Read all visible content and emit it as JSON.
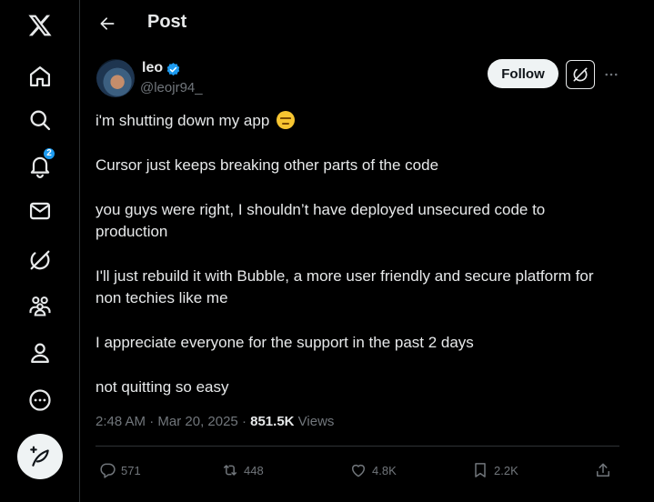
{
  "header": {
    "title": "Post"
  },
  "nav": {
    "notifications_badge": "2"
  },
  "author": {
    "display_name": "leo",
    "handle": "@leojr94_"
  },
  "buttons": {
    "follow_label": "Follow"
  },
  "post": {
    "line1": "i'm shutting down my app",
    "line2": "Cursor just keeps breaking other parts of the code",
    "line3": "you guys were right, I shouldn’t have deployed unsecured code to production",
    "line4": "I'll just rebuild it with Bubble, a more user friendly and secure platform for non techies like me",
    "line5": "I appreciate everyone for the support in the past 2 days",
    "line6": "not quitting so easy",
    "emoji": "expressionless-face"
  },
  "meta": {
    "time": "2:48 AM",
    "date": "Mar 20, 2025",
    "views_count": "851.5K",
    "views_label": "Views"
  },
  "stats": {
    "replies": "571",
    "reposts": "448",
    "likes": "4.8K",
    "bookmarks": "2.2K"
  },
  "colors": {
    "background": "#000000",
    "text": "#e7e9ea",
    "secondary": "#71767b",
    "accent": "#1d9bf0",
    "border": "#2f3336"
  },
  "icons": [
    "x-logo-icon",
    "home-icon",
    "search-icon",
    "bell-icon",
    "mail-icon",
    "grok-icon",
    "communities-icon",
    "profile-icon",
    "more-circle-icon",
    "compose-icon",
    "back-arrow-icon",
    "verified-icon",
    "ellipsis-icon",
    "reply-icon",
    "repost-icon",
    "heart-icon",
    "bookmark-icon",
    "share-icon"
  ]
}
